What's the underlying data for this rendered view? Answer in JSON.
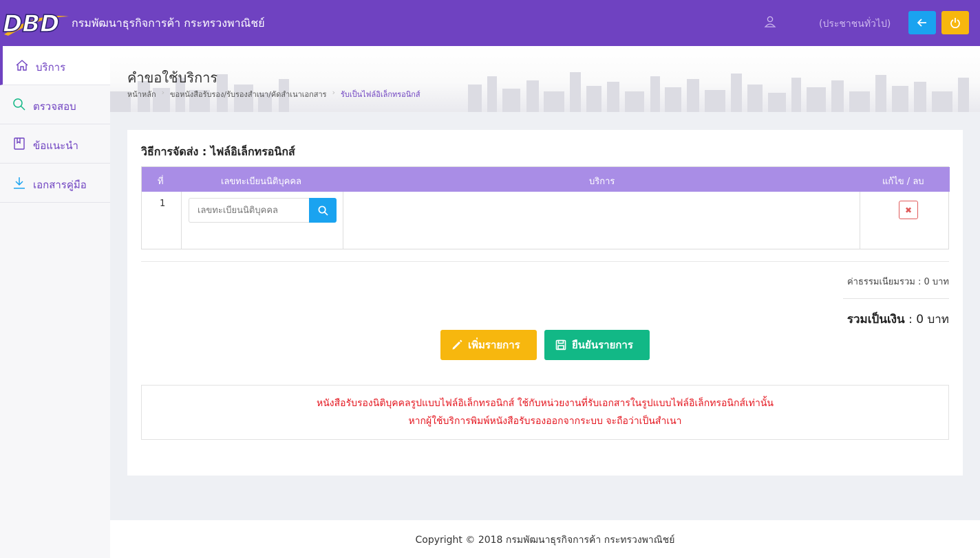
{
  "header": {
    "logo_text": "DBD",
    "org_title": "กรมพัฒนาธุรกิจการค้า กระทรวงพาณิชย์",
    "user_role": "(ประชาชนทั่วไป)",
    "icons": {
      "user": "user-icon",
      "back": "arrow-left-icon",
      "power": "power-icon"
    },
    "accent_color": "#6f42c1"
  },
  "sidebar": {
    "items": [
      {
        "label": "บริการ",
        "icon": "home-icon",
        "active": true
      },
      {
        "label": "ตรวจสอบ",
        "icon": "search-icon",
        "active": false
      },
      {
        "label": "ข้อแนะนำ",
        "icon": "book-icon",
        "active": false
      },
      {
        "label": "เอกสารคู่มือ",
        "icon": "download-icon",
        "active": false
      }
    ]
  },
  "page": {
    "title": "คำขอใช้บริการ",
    "breadcrumb": [
      "หน้าหลัก",
      "ขอหนังสือรับรอง/รับรองสำเนา/คัดสำเนาเอกสาร",
      "รับเป็นไฟล์อิเล็กทรอนิกส์"
    ]
  },
  "form": {
    "delivery_method": "วิธีการจัดส่ง : ไฟล์อิเล็กทรอนิกส์",
    "table": {
      "headers": [
        "ที่",
        "เลขทะเบียนนิติบุคคล",
        "บริการ",
        "แก้ไข / ลบ"
      ],
      "rows": [
        {
          "no": "1",
          "reg_placeholder": "เลขทะเบียนนิติบุคคล",
          "service": ""
        }
      ]
    },
    "fee_total": "ค่าธรรมเนียมรวม : 0 บาท",
    "grand_total_label": "รวมเป็นเงิน",
    "grand_total_value": ": 0 บาท",
    "add_button": "เพิ่มรายการ",
    "confirm_button": "ยืนยันรายการ",
    "notice_lines": [
      "หนังสือรับรองนิติบุคคลรูปแบบไฟล์อิเล็กทรอนิกส์ ใช้กับหน่วยงานที่รับเอกสารในรูปแบบไฟล์อิเล็กทรอนิกส์เท่านั้น",
      "หากผู้ใช้บริการพิมพ์หนังสือรับรองออกจากระบบ จะถือว่าเป็นสำเนา"
    ],
    "colors": {
      "add": "#f7b70e",
      "confirm": "#12b886",
      "notice": "#e4161f",
      "table_header": "#a98de6",
      "search": "#1aa3f0"
    }
  },
  "footer": {
    "text": "Copyright © 2018 กรมพัฒนาธุรกิจการค้า กระทรวงพาณิชย์"
  }
}
